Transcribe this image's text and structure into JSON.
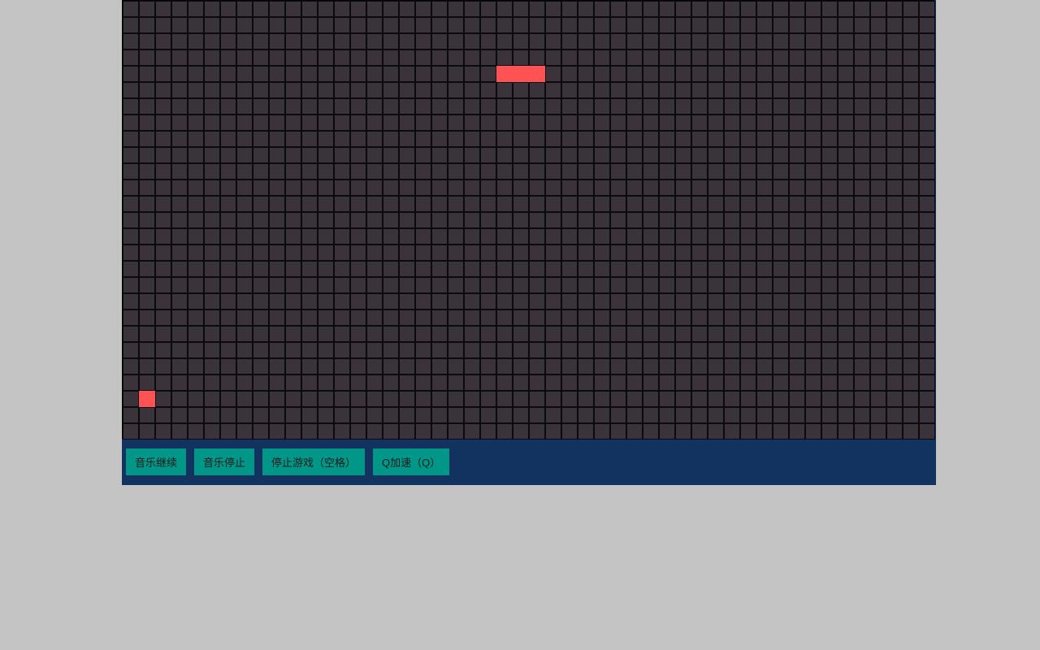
{
  "board": {
    "cols": 50,
    "rows": 27,
    "cellSize": 20
  },
  "snake": {
    "segments": [
      {
        "col": 23,
        "row": 4
      },
      {
        "col": 24,
        "row": 4
      },
      {
        "col": 25,
        "row": 4
      }
    ]
  },
  "food": {
    "col": 1,
    "row": 24
  },
  "controls": {
    "music_resume": "音乐继续",
    "music_stop": "音乐停止",
    "pause_game": "停止游戏（空格）",
    "speed_up": "Q加速（Q）"
  }
}
